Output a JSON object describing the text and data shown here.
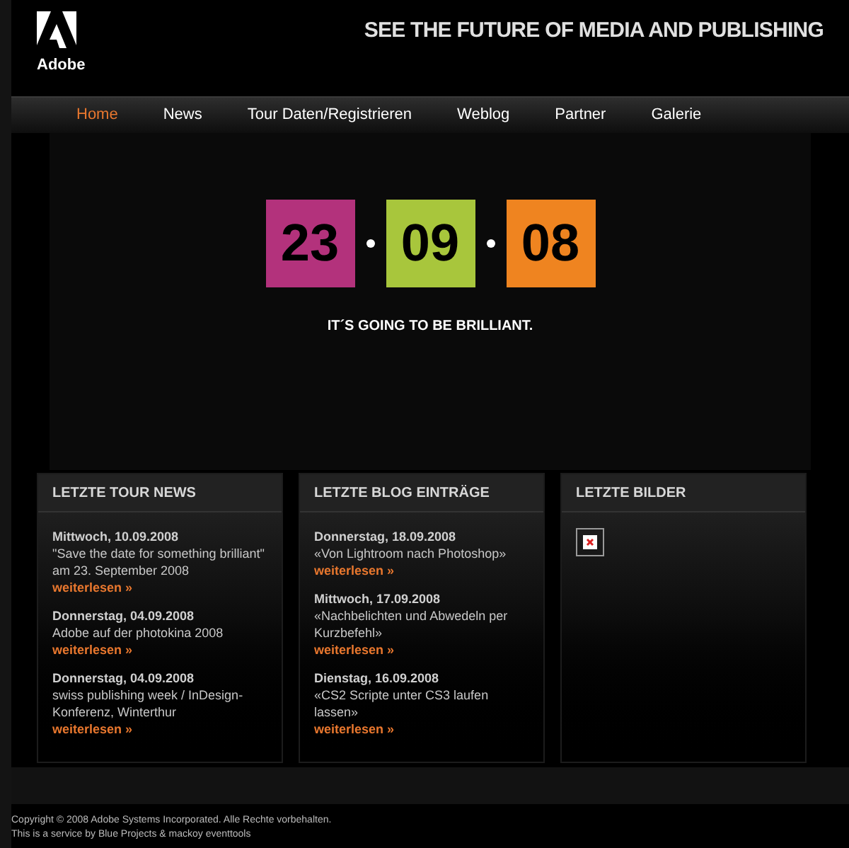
{
  "header": {
    "logo_text": "Adobe",
    "tagline": "SEE THE FUTURE OF MEDIA AND PUBLISHING"
  },
  "nav": [
    {
      "label": "Home",
      "selected": true
    },
    {
      "label": "News",
      "selected": false
    },
    {
      "label": "Tour Daten/Registrieren",
      "selected": false
    },
    {
      "label": "Weblog",
      "selected": false
    },
    {
      "label": "Partner",
      "selected": false
    },
    {
      "label": "Galerie",
      "selected": false
    }
  ],
  "countdown": {
    "tiles": [
      {
        "text": "23",
        "color": "#b3327c"
      },
      {
        "text": "09",
        "color": "#a8c63c"
      },
      {
        "text": "08",
        "color": "#ef8420"
      }
    ],
    "slogan": "IT´S GOING TO BE BRILLIANT."
  },
  "panels": [
    {
      "title": "LETZTE TOUR NEWS",
      "kind": "entries",
      "entries": [
        {
          "date": "Mittwoch, 10.09.2008",
          "text": "\"Save the date for something brilliant\" am 23. September 2008",
          "link": "weiterlesen »"
        },
        {
          "date": "Donnerstag, 04.09.2008",
          "text": "Adobe auf der photokina 2008",
          "link": "weiterlesen »"
        },
        {
          "date": "Donnerstag, 04.09.2008",
          "text": "swiss publishing week / InDesign-Konferenz, Winterthur",
          "link": "weiterlesen »"
        }
      ]
    },
    {
      "title": "LETZTE BLOG EINTRÄGE",
      "kind": "entries",
      "entries": [
        {
          "date": "Donnerstag, 18.09.2008",
          "text": "«Von Lightroom nach Photoshop»",
          "link": "weiterlesen »"
        },
        {
          "date": "Mittwoch, 17.09.2008",
          "text": "«Nachbelichten und Abwedeln per Kurzbefehl»",
          "link": "weiterlesen »"
        },
        {
          "date": "Dienstag, 16.09.2008",
          "text": "«CS2 Scripte unter CS3 laufen lassen»",
          "link": "weiterlesen »"
        }
      ]
    },
    {
      "title": "LETZTE BILDER",
      "kind": "images",
      "images": [
        {
          "kind": "broken"
        }
      ]
    }
  ],
  "footer": [
    "Copyright © 2008 Adobe Systems Incorporated. Alle Rechte vorbehalten.",
    "This is a service by Blue Projects & mackoy eventtools"
  ]
}
